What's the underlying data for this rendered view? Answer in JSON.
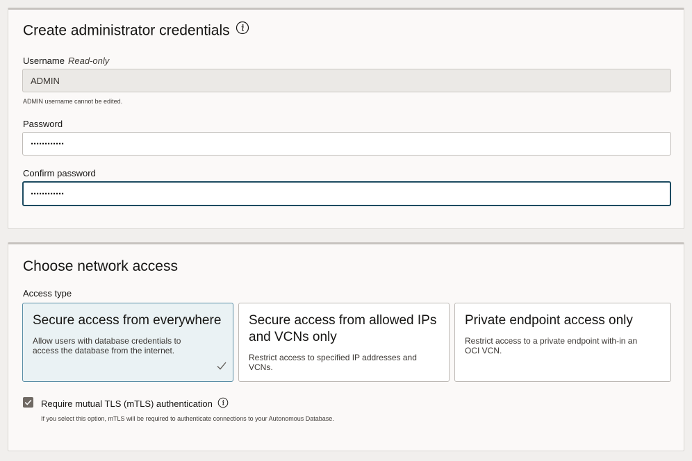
{
  "credentials": {
    "title": "Create administrator credentials",
    "username": {
      "label": "Username",
      "readonly_tag": "Read-only",
      "value": "ADMIN",
      "helper": "ADMIN username cannot be edited."
    },
    "password": {
      "label": "Password",
      "value": "············"
    },
    "confirm_password": {
      "label": "Confirm password",
      "value": "············"
    }
  },
  "network": {
    "title": "Choose network access",
    "access_type_label": "Access type",
    "options": [
      {
        "title": "Secure access from everywhere",
        "description": "Allow users with database credentials to access the database from the internet.",
        "selected": true
      },
      {
        "title": "Secure access from allowed IPs and VCNs only",
        "description": "Restrict access to specified IP addresses and VCNs.",
        "selected": false
      },
      {
        "title": "Private endpoint access only",
        "description": "Restrict access to a private endpoint with-in an OCI VCN.",
        "selected": false
      }
    ],
    "mtls": {
      "label": "Require mutual TLS (mTLS) authentication",
      "checked": true,
      "helper": "If you select this option, mTLS will be required to authenticate connections to your Autonomous Database."
    }
  },
  "icons": {
    "info": "info-icon",
    "check": "checkmark-icon",
    "checkbox": "checkbox-checked-icon"
  },
  "colors": {
    "focus_border": "#1d4b61",
    "selected_card_bg": "#eaf2f4",
    "selected_card_border": "#5a8ea6",
    "checkbox_fill": "#6f6963"
  }
}
